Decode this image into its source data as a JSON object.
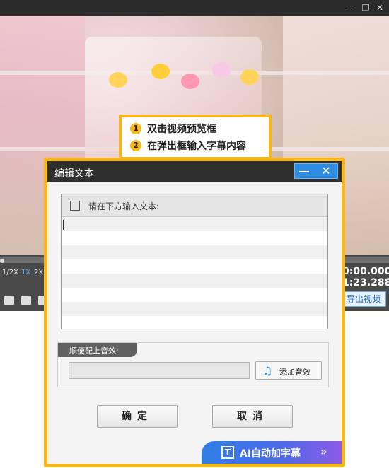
{
  "window": {
    "minimize": "—",
    "restore": "❐",
    "close": "✕"
  },
  "callout": {
    "step1_num": "1",
    "step1": "双击视频预览框",
    "step2_num": "2",
    "step2": "在弹出框输入字幕内容"
  },
  "player": {
    "speeds": [
      "1/2X",
      "1X",
      "2X"
    ],
    "active_speed": "1X",
    "time_current": "0:00.000",
    "time_total": "1:23.288",
    "export_label": "导出视频"
  },
  "dialog": {
    "title": "编辑文本",
    "min_icon": "minimize-icon",
    "close_icon": "✕",
    "text_prompt": "请在下方输入文本:",
    "text_value": "",
    "sound_label": "顺便配上音效:",
    "sound_value": "",
    "add_sound_label": "添加音效",
    "ok_label": "确定",
    "cancel_label": "取消",
    "ai_label": "AI自动加字幕"
  },
  "colors": {
    "accent": "#f5b81c",
    "blue": "#2e8de0",
    "dark": "#2f2f2f"
  }
}
